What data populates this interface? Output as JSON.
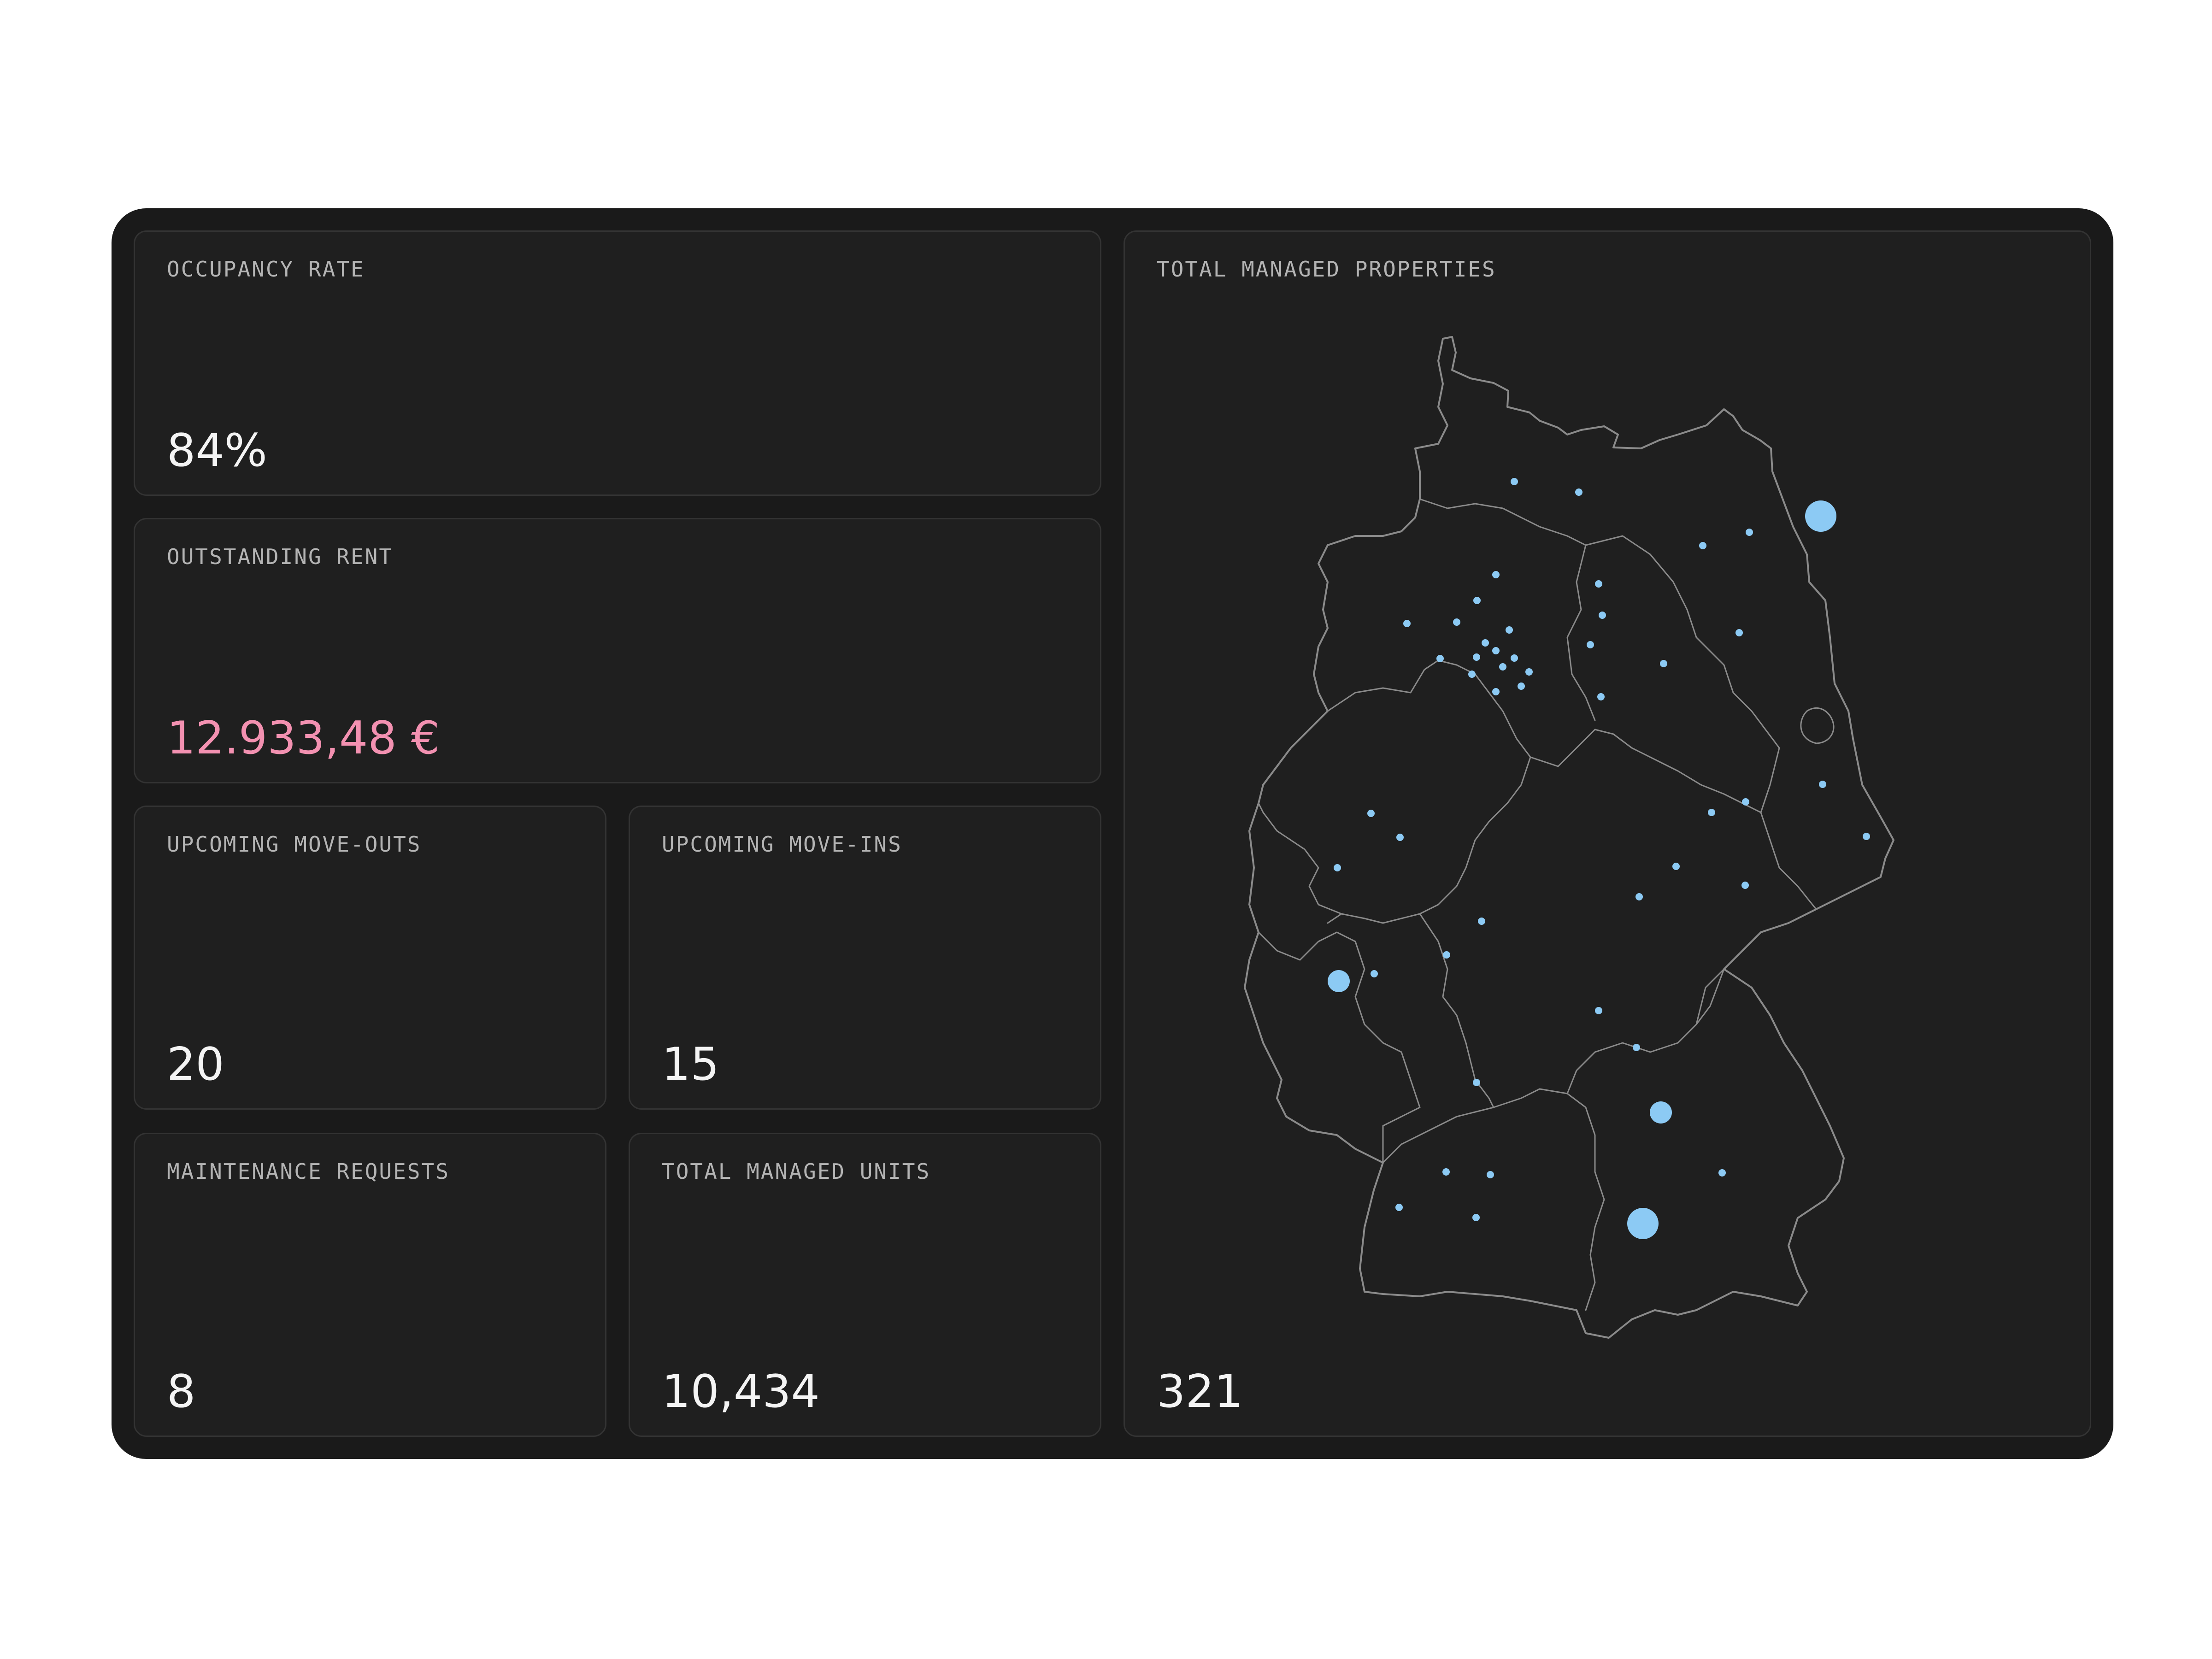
{
  "metrics": {
    "occupancy": {
      "label": "OCCUPANCY RATE",
      "value": "84%"
    },
    "outstanding_rent": {
      "label": "OUTSTANDING RENT",
      "value": "12.933,48 €"
    },
    "move_outs": {
      "label": "UPCOMING MOVE-OUTS",
      "value": "20"
    },
    "move_ins": {
      "label": "UPCOMING MOVE-INS",
      "value": "15"
    },
    "maintenance": {
      "label": "MAINTENANCE REQUESTS",
      "value": "8"
    },
    "units": {
      "label": "TOTAL MANAGED UNITS",
      "value": "10,434"
    },
    "properties": {
      "label": "TOTAL MANAGED PROPERTIES",
      "value": "321"
    }
  },
  "colors": {
    "panel_background": "#1a1a1a",
    "card_background": "#1f1f1f",
    "card_border": "#333333",
    "label_text": "#b4b4b4",
    "value_text": "#f4f4f4",
    "negative_value": "#f391b1",
    "map_outline": "#8a8a8a",
    "map_marker": "#8ccaf4"
  },
  "map": {
    "region": "Germany",
    "marker_icon": "property-location-marker",
    "marker_sizes": [
      "small",
      "large"
    ]
  }
}
